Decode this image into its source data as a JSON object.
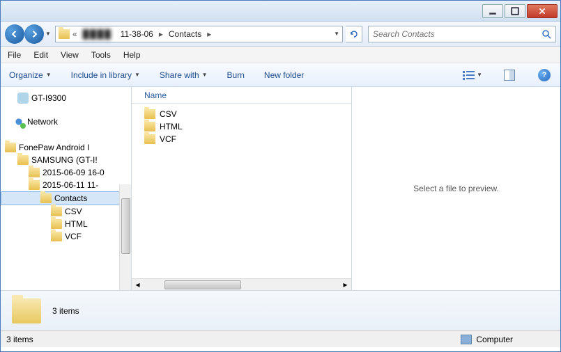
{
  "breadcrumbs": {
    "part1": "11-38-06",
    "part2": "Contacts"
  },
  "search": {
    "placeholder": "Search Contacts"
  },
  "menubar": {
    "file": "File",
    "edit": "Edit",
    "view": "View",
    "tools": "Tools",
    "help": "Help"
  },
  "toolbar": {
    "organize": "Organize",
    "include": "Include in library",
    "share": "Share with",
    "burn": "Burn",
    "newfolder": "New folder"
  },
  "tree": {
    "device": "GT-I9300",
    "network": "Network",
    "fonepaw": "FonePaw Android I",
    "samsung": "SAMSUNG (GT-I!",
    "date1": "2015-06-09 16-0",
    "date2": "2015-06-11 11-",
    "contacts": "Contacts",
    "csv": "CSV",
    "html": "HTML",
    "vcf": "VCF"
  },
  "filepane": {
    "column_name": "Name",
    "items": [
      "CSV",
      "HTML",
      "VCF"
    ]
  },
  "preview": {
    "text": "Select a file to preview."
  },
  "details": {
    "count": "3 items"
  },
  "statusbar": {
    "left": "3 items",
    "location": "Computer"
  }
}
